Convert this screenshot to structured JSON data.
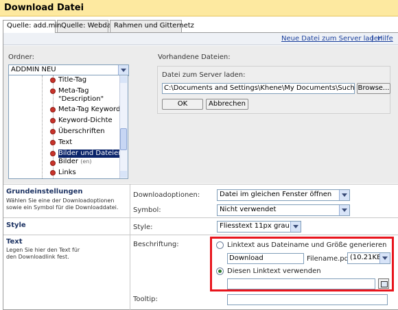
{
  "header": {
    "title": "Download Datei"
  },
  "tabs": [
    {
      "label": "Quelle: add.min",
      "active": true
    },
    {
      "label": "Quelle: Webdav",
      "active": false
    },
    {
      "label": "Rahmen und Gitternetz",
      "active": false
    }
  ],
  "linkbar": {
    "upload_link": "Neue Datei zum Server laden",
    "separator": "|",
    "help_link": "Hilfe"
  },
  "folder": {
    "label": "Ordner:",
    "selected": "ADDMIN NEU",
    "tree_items": [
      {
        "label": "Title-Tag"
      },
      {
        "label": "Meta-Tag"
      },
      {
        "label": "\"Description\""
      },
      {
        "label": "Meta-Tag Keywords"
      },
      {
        "label": "Keyword-Dichte"
      },
      {
        "label": "Überschriften"
      },
      {
        "label": "Text"
      },
      {
        "label": "Bilder und Dateien"
      },
      {
        "label": "Bilder",
        "suffix": "(en)"
      },
      {
        "label": "Links"
      }
    ]
  },
  "existing_files": {
    "label": "Vorhandene Dateien:"
  },
  "upload": {
    "label": "Datei zum Server laden:",
    "path_value": "C:\\Documents and Settings\\Khene\\My Documents\\Suchmaschine",
    "browse_label": "Browse...",
    "ok_label": "OK",
    "cancel_label": "Abbrechen"
  },
  "grundeinstellungen": {
    "title": "Grundeinstellungen",
    "description": "Wählen Sie eine der Downloadoptionen sowie ein Symbol für die Downloaddatei.",
    "download_options_label": "Downloadoptionen:",
    "download_options_value": "Datei im gleichen Fenster öffnen",
    "symbol_label": "Symbol:",
    "symbol_value": "Nicht verwendet"
  },
  "style_section": {
    "title": "Style",
    "style_label": "Style:",
    "style_value": "Fliesstext 11px grau"
  },
  "text_section": {
    "title": "Text",
    "description": "Legen Sie hier den Text für den Downloadlink fest.",
    "beschriftung_label": "Beschriftung:",
    "radio_auto_label": "Linktext aus Dateiname und Größe generieren",
    "download_input_value": "Download",
    "filename_text": "Filename.pdf",
    "size_value": "(10.21KB)",
    "radio_custom_label": "Diesen Linktext verwenden",
    "custom_input_value": "",
    "tooltip_label": "Tooltip:",
    "tooltip_value": ""
  },
  "colors": {
    "header_bg": "#fde9a0",
    "highlight_box": "#e8141c",
    "link": "#1a3f9c",
    "selected_item": "#0a246a"
  }
}
